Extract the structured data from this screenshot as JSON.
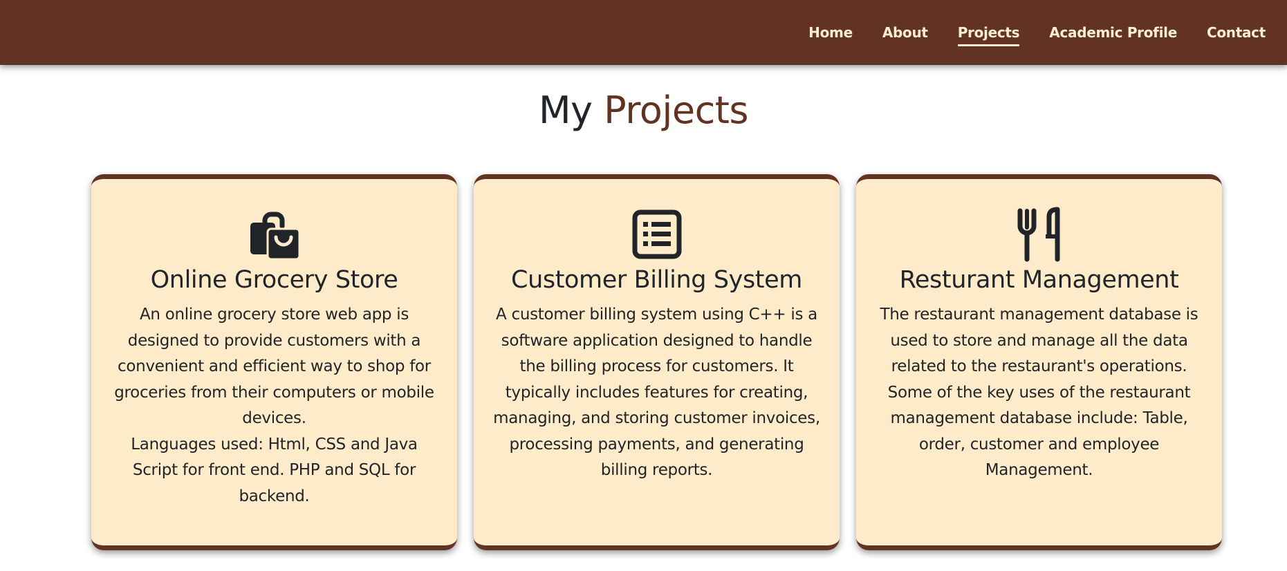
{
  "nav": {
    "links": [
      {
        "label": "Home",
        "active": false
      },
      {
        "label": "About",
        "active": false
      },
      {
        "label": "Projects",
        "active": true
      },
      {
        "label": "Academic Profile",
        "active": false
      },
      {
        "label": "Contact",
        "active": false
      }
    ]
  },
  "main": {
    "title_prefix": "My",
    "title_accent": "Projects"
  },
  "projects": [
    {
      "icon": "shopping-bag-icon",
      "title": "Online Grocery Store",
      "description": "An online grocery store web app is designed to provide customers with a convenient and efficient way to shop for groceries from their computers or mobile devices.",
      "languages": "Languages used: Html, CSS and Java Script for front end. PHP and SQL for backend."
    },
    {
      "icon": "list-icon",
      "title": "Customer Billing System",
      "description": "A customer billing system using C++ is a software application designed to handle the billing process for customers. It typically includes features for creating, managing, and storing customer invoices, processing payments, and generating billing reports."
    },
    {
      "icon": "fork-knife-icon",
      "title": "Resturant Management",
      "description": "The restaurant management database is used to store and manage all the data related to the restaurant's operations. Some of the key uses of the restaurant management database include: Table, order, customer and employee Management."
    }
  ],
  "colors": {
    "brand": "#623322",
    "nav_text": "#fbeed2",
    "card_bg": "#fdebc9",
    "text": "#212529"
  }
}
